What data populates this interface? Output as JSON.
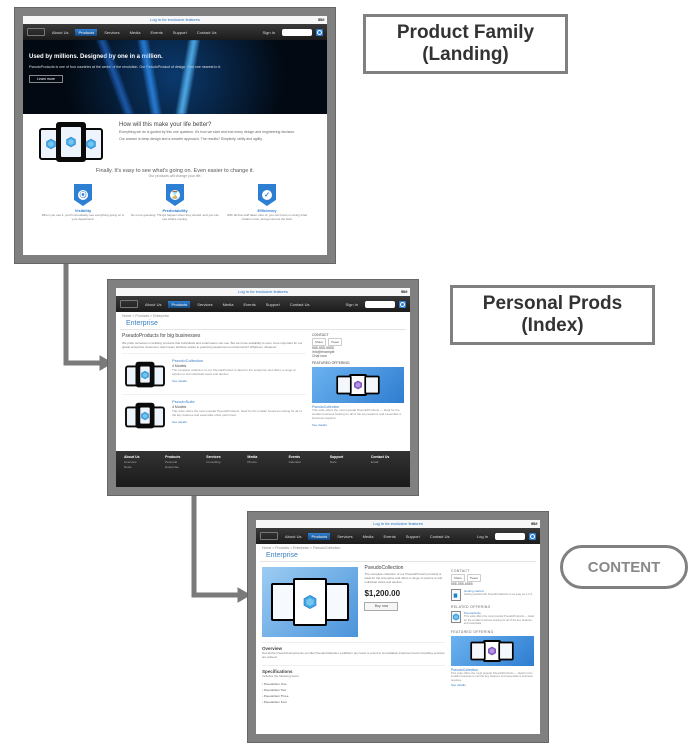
{
  "diagram": {
    "label1_line1": "Product Family",
    "label1_line2": "(Landing)",
    "label2_line1": "Personal Prods",
    "label2_line2": "(Index)",
    "label3": "CONTENT"
  },
  "common": {
    "topstrip": "Log in for exclusive features",
    "ibm": "IBM",
    "nav": {
      "about": "About Us",
      "products": "Products",
      "services": "Services",
      "media": "Media",
      "events": "Events",
      "support": "Support",
      "contact": "Contact Us",
      "signin": "Sign In",
      "login": "Log In"
    }
  },
  "card1": {
    "hero_title": "Used by millions. Designed by one in a million.",
    "hero_sub": "PseudoProducts is one of four countries at the center of the revolution. Our PseudoProduct of design. Find one nearest to it.",
    "hero_btn": "Learn more",
    "feat_h": "How will this make your life better?",
    "feat_p1": "Everything we do is guided by this one question. It's how we start and end every design and engineering decision.",
    "feat_p2": "Our answer is deep design and a smarter approach. The results? Simplicity, utility and agility.",
    "mid_h": "Finally. It's easy to see what's going on. Even easier to change it.",
    "mid_p": "Our products will change your life.",
    "badges": [
      {
        "title": "Visibility",
        "desc": "When you use it, you'll immediately see everything going on in your department."
      },
      {
        "title": "Predictability",
        "desc": "No more guessing. Things happen when they should, and you can see what's coming."
      },
      {
        "title": "Efficiency",
        "desc": "With all that stuff taken care of, you can focus on doing what matters most, and get across the field."
      }
    ]
  },
  "card2": {
    "crumb": "Home > Products > Enterprise",
    "cat": "Enterprise",
    "index_h": "PseudoProducts for big businesses",
    "index_p": "We pride ourselves in building products that individuals and small teams can use. But we know scalability is even more important for our global enterprise customers. Each team attribute scales to guard big department environments? Whatever, whatever.",
    "prods": [
      {
        "name": "PseudoCollection",
        "meta": "4 Models",
        "desc": "The complete collection of our PseudoProduct is ideal for the enterprise and offers a range of options to suit individual views and desires.",
        "link": "See details"
      },
      {
        "name": "PseudoSuite",
        "meta": "4 Models",
        "desc": "This suite offers the most popular PseudoProducts. Ideal for the smaller business looking for all of the key features and essentials show performed.",
        "link": "See details"
      }
    ],
    "side": {
      "contact_h": "CONTACT",
      "share": [
        "Share",
        "Tweet"
      ],
      "phone": "555-555-5555",
      "email": "info@example",
      "chat": "Chat now",
      "feat_h": "FEATURED OFFERING",
      "feat_name": "PseudoCollection",
      "feat_desc": "This suite offers the most popular PseudoProducts — ideal for the smaller business looking for all of the key features and essentials a business requires.",
      "feat_link": "See details"
    },
    "footer": {
      "cols": [
        {
          "h": "About Us",
          "items": [
            "Overview",
            "News",
            "Team"
          ]
        },
        {
          "h": "Products",
          "items": [
            "Personal",
            "Enterprise"
          ]
        },
        {
          "h": "Services",
          "items": [
            "Consulting",
            "Training"
          ]
        },
        {
          "h": "Media",
          "items": [
            "Photos",
            "Video"
          ]
        },
        {
          "h": "Events",
          "items": [
            "Calendar",
            "Workshops"
          ]
        },
        {
          "h": "Support",
          "items": [
            "Docs",
            "Forums"
          ]
        },
        {
          "h": "Contact Us",
          "items": [
            "Email",
            "Phone"
          ]
        }
      ]
    }
  },
  "card3": {
    "crumb": "Home > Products > Enterprise > PseudoCollection",
    "cat": "Enterprise",
    "title": "PseudoCollection",
    "blurb": "The complete collection of our PseudoProduct products is ideal for the enterprise and offers a range of options to suit individual views and desires.",
    "price": "$1,200.00",
    "buy": "Buy now",
    "overview_h": "Overview",
    "overview_p": "Get all the PseudoComponents you like PseudoCollection a platform any team is proud to immediately implement and consulting services are waived.",
    "spec_h": "Specifications",
    "spec_lead": "Includes the following items:",
    "specs": [
      "PseudoItem One",
      "PseudoItem Two",
      "PseudoItem Three",
      "PseudoItem Four"
    ],
    "side": {
      "contact_h": "CONTACT",
      "share": [
        "Share",
        "Tweet"
      ],
      "phone": "555-555-5555",
      "getstart_h": "Getting started",
      "getstart_d": "Getting started with PseudoCollection is as easy as 1-2-3.",
      "related_h": "RELATED OFFERING",
      "rel_name": "PseudoSuite",
      "rel_desc": "This suite offers the most popular PseudoProducts — ideal for the smaller business looking for all of the key features and essentials.",
      "feat_h": "FEATURED OFFERING",
      "feat_name": "PseudoCollection",
      "feat_desc": "This suite offers the most popular PseudoProducts — ideal for the smaller business for all the key features and essentials a business requires.",
      "feat_link": "See details"
    }
  }
}
